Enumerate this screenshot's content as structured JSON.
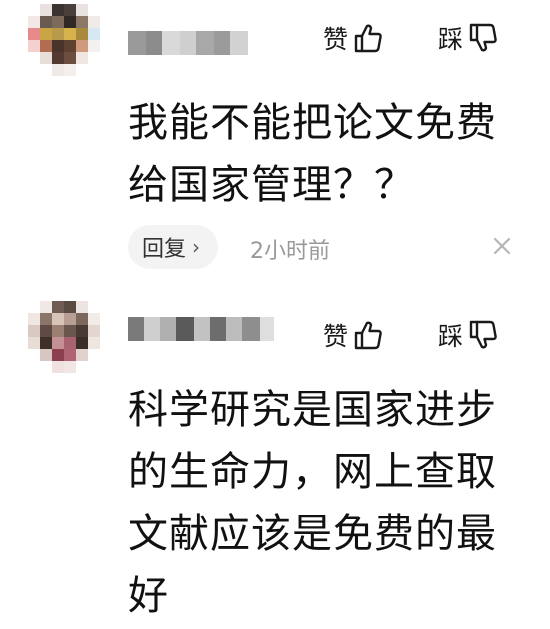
{
  "comments": [
    {
      "vote": {
        "like_label": "赞",
        "dislike_label": "踩"
      },
      "content": "我能不能把论文免费给国家管理？？",
      "reply_label": "回复",
      "timestamp": "2小时前"
    },
    {
      "vote": {
        "like_label": "赞",
        "dislike_label": "踩"
      },
      "content": "科学研究是国家进步的生命力，网上查取文献应该是免费的最好"
    }
  ],
  "icons": {
    "like": "thumbs-up-icon",
    "dislike": "thumbs-down-icon",
    "reply_chevron": "chevron-right-icon",
    "close": "close-icon"
  },
  "colors": {
    "text": "#111111",
    "muted": "#999999",
    "reply_bg": "#f3f3f3"
  }
}
